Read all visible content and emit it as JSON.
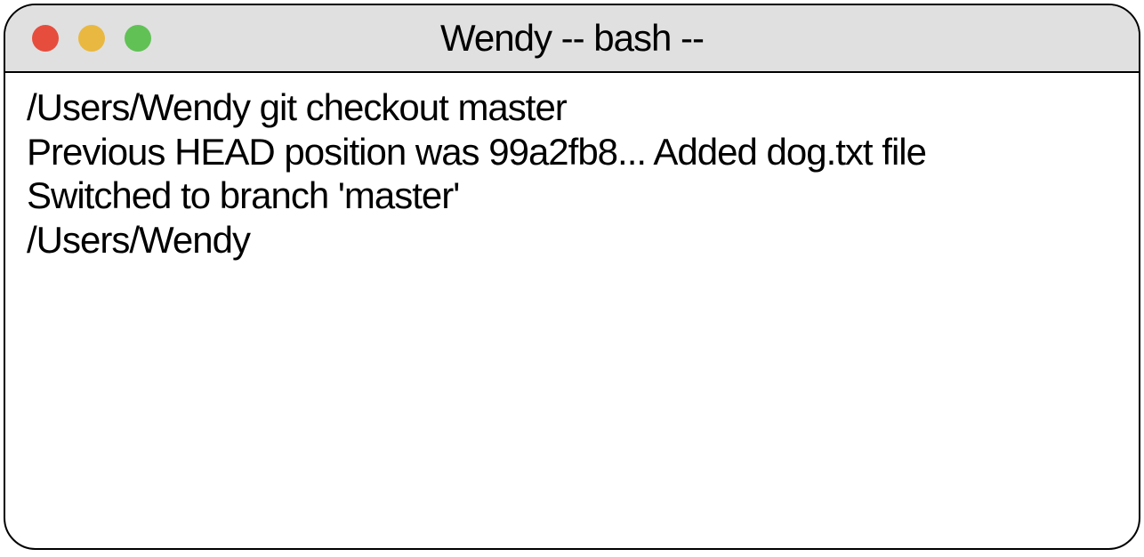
{
  "window": {
    "title": "Wendy -- bash --"
  },
  "terminal": {
    "lines": [
      "/Users/Wendy git checkout master",
      "Previous HEAD position was 99a2fb8... Added dog.txt file",
      "Switched to branch 'master'",
      "/Users/Wendy"
    ]
  },
  "colors": {
    "close": "#e64d3d",
    "minimize": "#e9b840",
    "zoom": "#61c155",
    "titlebar_bg": "#e0e0e0"
  }
}
